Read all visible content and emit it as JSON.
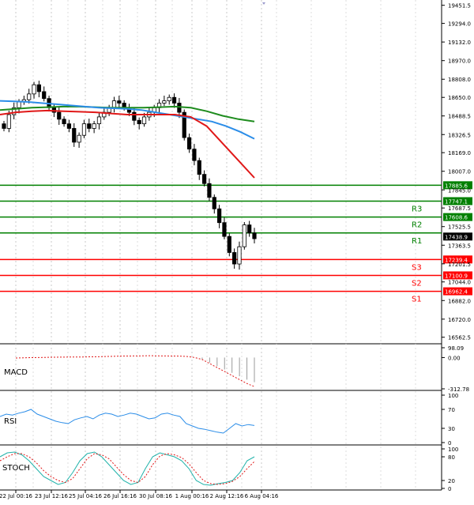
{
  "chart_data": {
    "type": "candlestick",
    "main": {
      "y_ticks": [
        19451.5,
        19294.0,
        19132.0,
        18970.0,
        18808.0,
        18650.0,
        18488.5,
        18326.5,
        18169.0,
        18007.0,
        17845.0,
        17687.5,
        17525.5,
        17363.5,
        17201.5,
        17044.0,
        16882.0,
        16720.0,
        16562.5
      ],
      "ylim": [
        16540,
        19470
      ],
      "last_price": "17438.9",
      "levels": [
        {
          "value": 17885.6,
          "label": "17885.6",
          "name": "",
          "color": "#008000"
        },
        {
          "value": 17747.1,
          "label": "17747.1",
          "name": "R3",
          "color": "#008000"
        },
        {
          "value": 17608.6,
          "label": "17608.6",
          "name": "R2",
          "color": "#008000"
        },
        {
          "value": 17470.0,
          "label": "",
          "name": "R1",
          "color": "#008000"
        },
        {
          "value": 17239.4,
          "label": "17239.4",
          "name": "S3",
          "color": "#ff0000"
        },
        {
          "value": 17100.9,
          "label": "17100.9",
          "name": "S2",
          "color": "#ff0000"
        },
        {
          "value": 16962.4,
          "label": "16962.4",
          "name": "S1",
          "color": "#ff0000"
        }
      ],
      "candles_close": [
        18380,
        18500,
        18560,
        18610,
        18630,
        18680,
        18760,
        18700,
        18640,
        18560,
        18520,
        18460,
        18420,
        18380,
        18260,
        18320,
        18420,
        18380,
        18420,
        18480,
        18520,
        18560,
        18620,
        18600,
        18560,
        18520,
        18450,
        18420,
        18480,
        18520,
        18560,
        18600,
        18620,
        18650,
        18600,
        18520,
        18300,
        18200,
        18100,
        17980,
        17900,
        17780,
        17680,
        17560,
        17440,
        17300,
        17200,
        17350,
        17540,
        17470,
        17420
      ],
      "ma_blue": [
        18620,
        18615,
        18610,
        18600,
        18590,
        18580,
        18570,
        18560,
        18555,
        18550,
        18540,
        18520,
        18500,
        18480,
        18460,
        18440,
        18400,
        18350,
        18290
      ],
      "ma_red": [
        18500,
        18520,
        18530,
        18535,
        18530,
        18525,
        18520,
        18510,
        18500,
        18500,
        18500,
        18500,
        18480,
        18400,
        18250,
        18100,
        17950
      ],
      "ma_green": [
        18540,
        18550,
        18560,
        18565,
        18570,
        18570,
        18565,
        18560,
        18560,
        18560,
        18565,
        18570,
        18560,
        18530,
        18490,
        18460,
        18440
      ]
    },
    "x_ticks": [
      "22 Jul 00:16",
      "23 Jul 12:16",
      "25 Jul 04:16",
      "26 Jul 16:16",
      "30 Jul 08:16",
      "1 Aug 00:16",
      "2 Aug 12:16",
      "6 Aug 04:16"
    ],
    "macd": {
      "name": "MACD",
      "y_ticks": [
        98.09,
        0.0,
        -312.78
      ],
      "signal": [
        -5,
        -3,
        -1,
        0,
        2,
        3,
        4,
        5,
        6,
        6,
        7,
        8,
        10,
        12,
        14,
        15,
        16,
        17,
        18,
        17,
        16,
        15,
        14,
        10,
        0,
        -20,
        -60,
        -100,
        -140,
        -180,
        -220,
        -260,
        -290
      ]
    },
    "rsi": {
      "name": "RSI",
      "y_ticks": [
        100,
        70,
        30,
        0
      ],
      "values": [
        55,
        60,
        58,
        62,
        65,
        70,
        60,
        55,
        50,
        45,
        42,
        40,
        48,
        52,
        55,
        50,
        58,
        62,
        60,
        55,
        58,
        62,
        60,
        55,
        50,
        52,
        60,
        62,
        58,
        55,
        40,
        35,
        30,
        28,
        25,
        22,
        20,
        30,
        40,
        35,
        38,
        36
      ]
    },
    "stoch": {
      "name": "STOCH",
      "y_ticks": [
        100,
        80,
        20,
        0
      ],
      "k": [
        80,
        90,
        92,
        85,
        70,
        50,
        30,
        20,
        10,
        15,
        40,
        70,
        88,
        92,
        80,
        60,
        40,
        20,
        10,
        15,
        50,
        80,
        90,
        85,
        80,
        70,
        50,
        20,
        10,
        8,
        12,
        15,
        20,
        40,
        70,
        80
      ],
      "d": [
        70,
        80,
        88,
        88,
        80,
        65,
        45,
        30,
        20,
        15,
        25,
        50,
        75,
        88,
        85,
        75,
        55,
        35,
        20,
        15,
        30,
        60,
        82,
        88,
        85,
        78,
        62,
        40,
        20,
        12,
        10,
        12,
        18,
        30,
        50,
        68
      ]
    }
  }
}
